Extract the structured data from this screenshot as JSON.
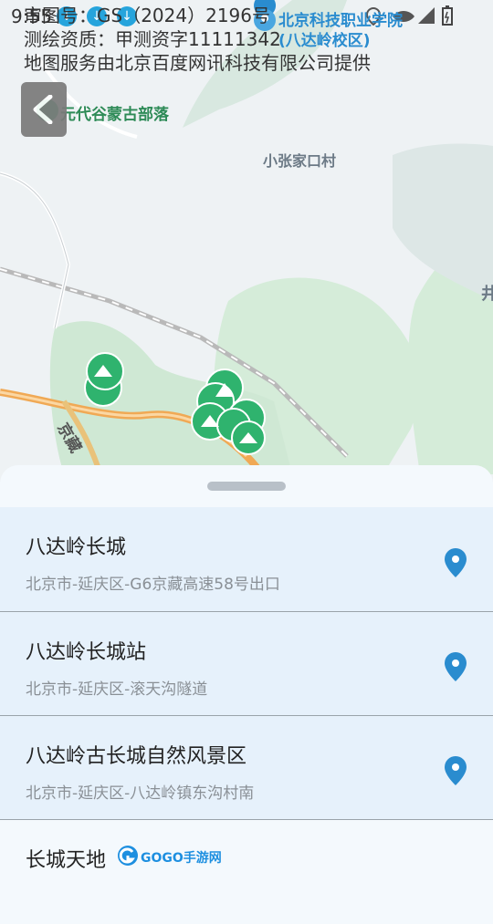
{
  "status_bar": {
    "time": "9:55",
    "notif_icon": "↓"
  },
  "map_copyright": {
    "line1": "审图号：GS（2024）2196号",
    "line2": "测绘资质：甲测资字11111342",
    "line3": "地图服务由北京百度网讯科技有限公司提供"
  },
  "map_labels": {
    "poi_college_line1": "北京科技职业学院",
    "poi_college_line2": "(八达岭校区)",
    "poi_yuandaigu": "元代谷蒙古部落",
    "village": "小张家口村",
    "edge_glyph": "井",
    "road": "京藏"
  },
  "results": [
    {
      "name": "八达岭长城",
      "address": "北京市-延庆区-G6京藏高速58号出口"
    },
    {
      "name": "八达岭长城站",
      "address": "北京市-延庆区-滚天沟隧道"
    },
    {
      "name": "八达岭古长城自然风景区",
      "address": "北京市-延庆区-八达岭镇东沟村南"
    },
    {
      "name": "长城天地",
      "address": ""
    }
  ],
  "watermark": "GOGO手游网",
  "colors": {
    "accent": "#2a8ccf",
    "park_green": "#2fb36e",
    "sheet_bg": "#e6f1fb"
  }
}
